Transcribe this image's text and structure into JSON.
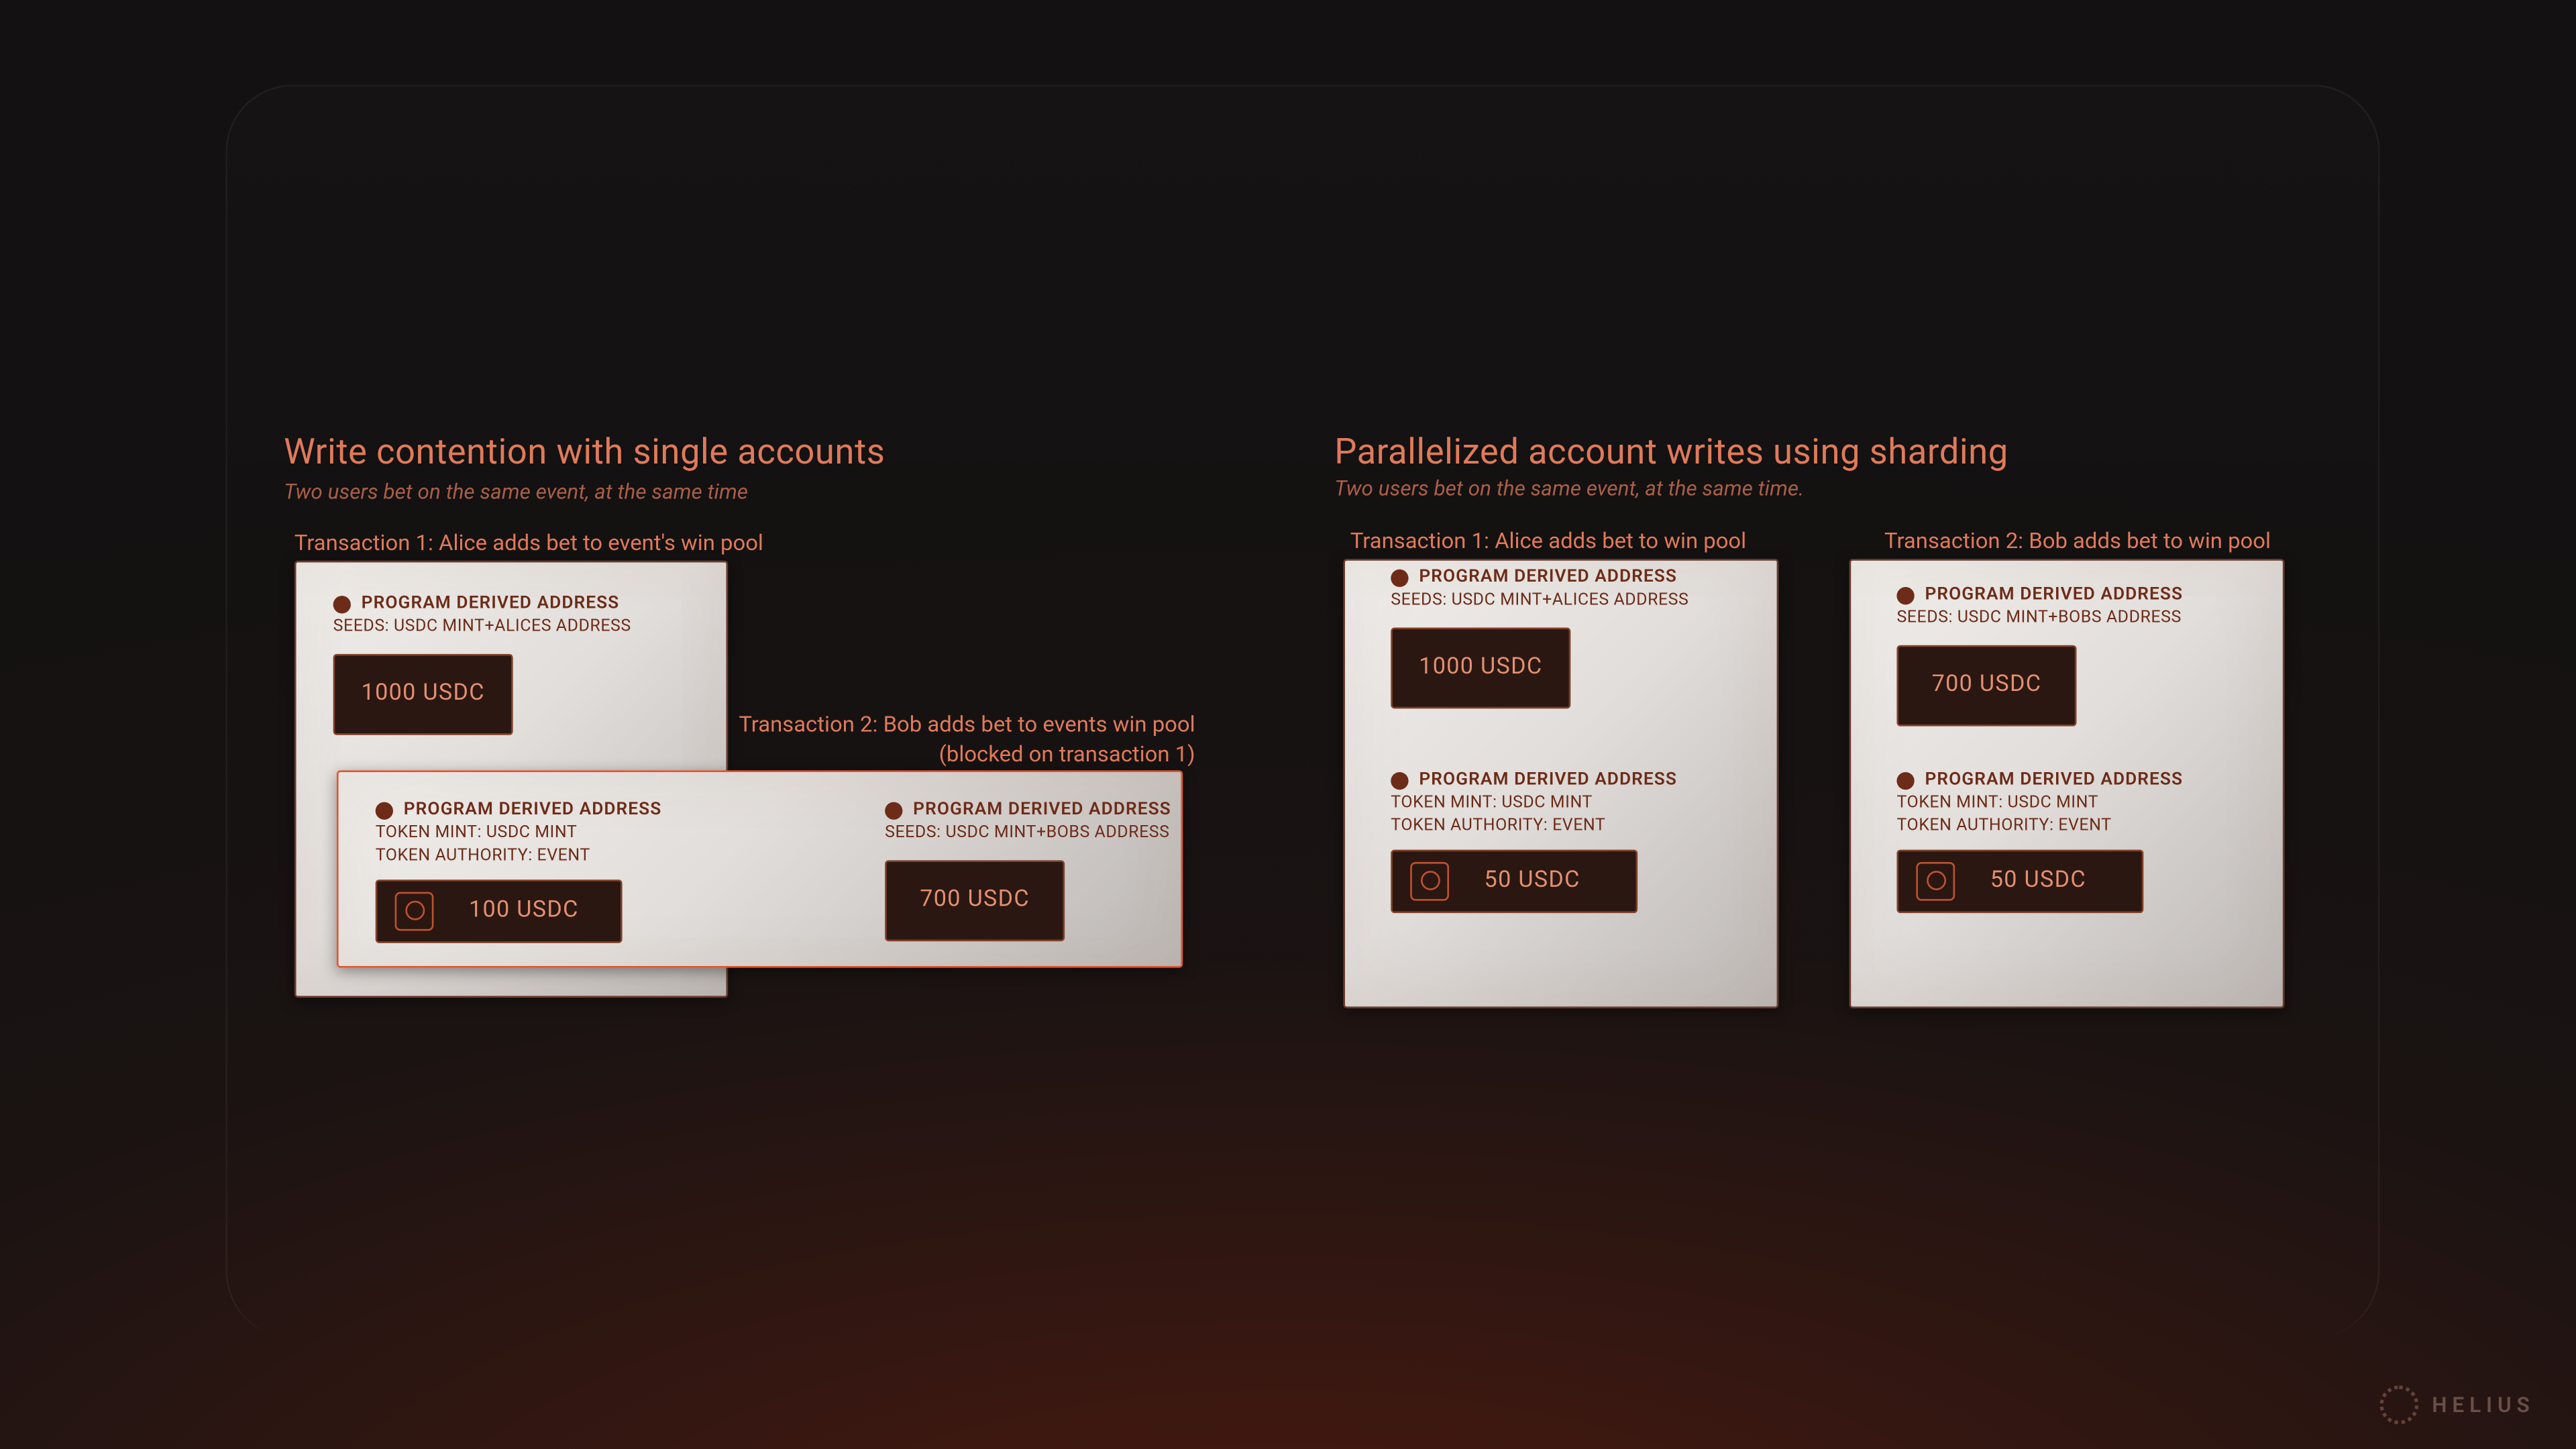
{
  "brand": "HELIUS",
  "left": {
    "title": "Write contention with single accounts",
    "subtitle": "Two users bet on the same event, at the same time",
    "tx1_label": "Transaction 1: Alice adds bet to event's win pool",
    "tx2_label_l1": "Transaction 2: Bob adds bet to events win pool",
    "tx2_label_l2": "(blocked on transaction 1)",
    "card1": {
      "pda_label": "PROGRAM DERIVED ADDRESS",
      "seeds": "SEEDS: USDC MINT+ALICES ADDRESS",
      "amount": "1000 USDC"
    },
    "card_overlap_left": {
      "pda_label": "PROGRAM DERIVED ADDRESS",
      "meta1": "TOKEN MINT: USDC MINT",
      "meta2": "TOKEN AUTHORITY: EVENT",
      "amount": "100 USDC"
    },
    "card_overlap_right": {
      "pda_label": "PROGRAM DERIVED ADDRESS",
      "seeds": "SEEDS: USDC MINT+BOBS ADDRESS",
      "amount": "700 USDC"
    }
  },
  "right": {
    "title": "Parallelized account writes using sharding",
    "subtitle": "Two users bet on the same event, at the same time.",
    "tx1_label": "Transaction 1: Alice adds bet to win pool",
    "tx2_label": "Transaction 2: Bob adds bet to win pool",
    "card1_top": {
      "pda_label": "PROGRAM DERIVED ADDRESS",
      "seeds": "SEEDS: USDC MINT+ALICES ADDRESS",
      "amount": "1000 USDC"
    },
    "card1_bottom": {
      "pda_label": "PROGRAM DERIVED ADDRESS",
      "meta1": "TOKEN MINT: USDC MINT",
      "meta2": "TOKEN AUTHORITY: EVENT",
      "amount": "50 USDC"
    },
    "card2_top": {
      "pda_label": "PROGRAM DERIVED ADDRESS",
      "seeds": "SEEDS: USDC MINT+BOBS ADDRESS",
      "amount": "700 USDC"
    },
    "card2_bottom": {
      "pda_label": "PROGRAM DERIVED ADDRESS",
      "meta1": "TOKEN MINT: USDC MINT",
      "meta2": "TOKEN AUTHORITY: EVENT",
      "amount": "50 USDC"
    }
  }
}
